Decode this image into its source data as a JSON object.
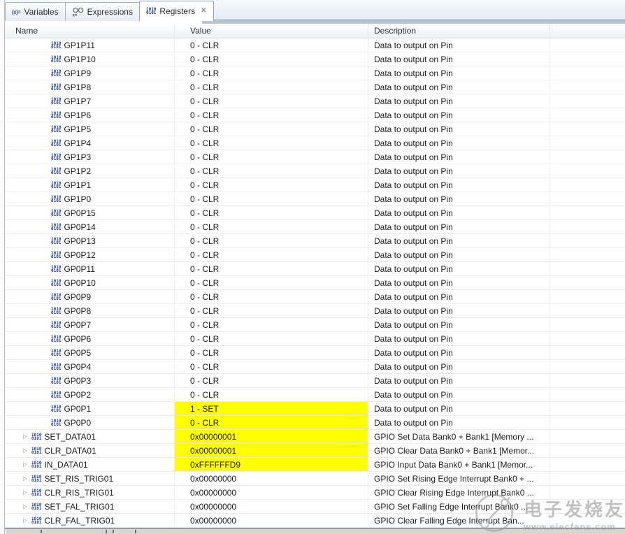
{
  "view": {
    "tabs": [
      {
        "label": "Variables"
      },
      {
        "label": "Expressions"
      },
      {
        "label": "Registers"
      }
    ],
    "close_glyph": "✕"
  },
  "icons": {
    "variables_glyph": "(x)=",
    "register_lines": [
      "1010",
      "0101"
    ],
    "expander_glyph": "▷"
  },
  "table": {
    "columns": [
      "Name",
      "Value",
      "Description"
    ],
    "rows": [
      {
        "name": "GP1P11",
        "value": "0 - CLR",
        "desc": "Data to output on Pin",
        "hl": false,
        "exp": false
      },
      {
        "name": "GP1P10",
        "value": "0 - CLR",
        "desc": "Data to output on Pin",
        "hl": false,
        "exp": false
      },
      {
        "name": "GP1P9",
        "value": "0 - CLR",
        "desc": "Data to output on Pin",
        "hl": false,
        "exp": false
      },
      {
        "name": "GP1P8",
        "value": "0 - CLR",
        "desc": "Data to output on Pin",
        "hl": false,
        "exp": false
      },
      {
        "name": "GP1P7",
        "value": "0 - CLR",
        "desc": "Data to output on Pin",
        "hl": false,
        "exp": false
      },
      {
        "name": "GP1P6",
        "value": "0 - CLR",
        "desc": "Data to output on Pin",
        "hl": false,
        "exp": false
      },
      {
        "name": "GP1P5",
        "value": "0 - CLR",
        "desc": "Data to output on Pin",
        "hl": false,
        "exp": false
      },
      {
        "name": "GP1P4",
        "value": "0 - CLR",
        "desc": "Data to output on Pin",
        "hl": false,
        "exp": false
      },
      {
        "name": "GP1P3",
        "value": "0 - CLR",
        "desc": "Data to output on Pin",
        "hl": false,
        "exp": false
      },
      {
        "name": "GP1P2",
        "value": "0 - CLR",
        "desc": "Data to output on Pin",
        "hl": false,
        "exp": false
      },
      {
        "name": "GP1P1",
        "value": "0 - CLR",
        "desc": "Data to output on Pin",
        "hl": false,
        "exp": false
      },
      {
        "name": "GP1P0",
        "value": "0 - CLR",
        "desc": "Data to output on Pin",
        "hl": false,
        "exp": false
      },
      {
        "name": "GP0P15",
        "value": "0 - CLR",
        "desc": "Data to output on Pin",
        "hl": false,
        "exp": false
      },
      {
        "name": "GP0P14",
        "value": "0 - CLR",
        "desc": "Data to output on Pin",
        "hl": false,
        "exp": false
      },
      {
        "name": "GP0P13",
        "value": "0 - CLR",
        "desc": "Data to output on Pin",
        "hl": false,
        "exp": false
      },
      {
        "name": "GP0P12",
        "value": "0 - CLR",
        "desc": "Data to output on Pin",
        "hl": false,
        "exp": false
      },
      {
        "name": "GP0P11",
        "value": "0 - CLR",
        "desc": "Data to output on Pin",
        "hl": false,
        "exp": false
      },
      {
        "name": "GP0P10",
        "value": "0 - CLR",
        "desc": "Data to output on Pin",
        "hl": false,
        "exp": false
      },
      {
        "name": "GP0P9",
        "value": "0 - CLR",
        "desc": "Data to output on Pin",
        "hl": false,
        "exp": false
      },
      {
        "name": "GP0P8",
        "value": "0 - CLR",
        "desc": "Data to output on Pin",
        "hl": false,
        "exp": false
      },
      {
        "name": "GP0P7",
        "value": "0 - CLR",
        "desc": "Data to output on Pin",
        "hl": false,
        "exp": false
      },
      {
        "name": "GP0P6",
        "value": "0 - CLR",
        "desc": "Data to output on Pin",
        "hl": false,
        "exp": false
      },
      {
        "name": "GP0P5",
        "value": "0 - CLR",
        "desc": "Data to output on Pin",
        "hl": false,
        "exp": false
      },
      {
        "name": "GP0P4",
        "value": "0 - CLR",
        "desc": "Data to output on Pin",
        "hl": false,
        "exp": false
      },
      {
        "name": "GP0P3",
        "value": "0 - CLR",
        "desc": "Data to output on Pin",
        "hl": false,
        "exp": false
      },
      {
        "name": "GP0P2",
        "value": "0 - CLR",
        "desc": "Data to output on Pin",
        "hl": false,
        "exp": false
      },
      {
        "name": "GP0P1",
        "value": "1 - SET",
        "desc": "Data to output on Pin",
        "hl": true,
        "exp": false
      },
      {
        "name": "GP0P0",
        "value": "0 - CLR",
        "desc": "Data to output on Pin",
        "hl": true,
        "exp": false
      },
      {
        "name": "SET_DATA01",
        "value": "0x00000001",
        "desc": "GPIO Set Data Bank0 + Bank1 [Memory ...",
        "hl": true,
        "exp": true
      },
      {
        "name": "CLR_DATA01",
        "value": "0x00000001",
        "desc": "GPIO Clear Data Bank0 + Bank1 [Memor...",
        "hl": true,
        "exp": true
      },
      {
        "name": "IN_DATA01",
        "value": "0xFFFFFFD9",
        "desc": "GPIO Input Data Bank0 + Bank1 [Memor...",
        "hl": true,
        "exp": true
      },
      {
        "name": "SET_RIS_TRIG01",
        "value": "0x00000000",
        "desc": "GPIO Set Rising Edge Interrupt Bank0 + ...",
        "hl": false,
        "exp": true
      },
      {
        "name": "CLR_RIS_TRIG01",
        "value": "0x00000000",
        "desc": "GPIO Clear Rising Edge Interrupt Bank0 ...",
        "hl": false,
        "exp": true
      },
      {
        "name": "SET_FAL_TRIG01",
        "value": "0x00000000",
        "desc": "GPIO Set Falling Edge Interrupt Bank0 ...",
        "hl": false,
        "exp": true
      },
      {
        "name": "CLR_FAL_TRIG01",
        "value": "0x00000000",
        "desc": "GPIO Clear Falling Edge Interrupt Ban...",
        "hl": false,
        "exp": true
      }
    ]
  },
  "watermark": {
    "brand": "电子发烧友",
    "url": "www.elecfans.com"
  },
  "colors": {
    "highlight": "#ffff00",
    "icon_blue": "#20388c",
    "strip": "#b9c4d2"
  }
}
